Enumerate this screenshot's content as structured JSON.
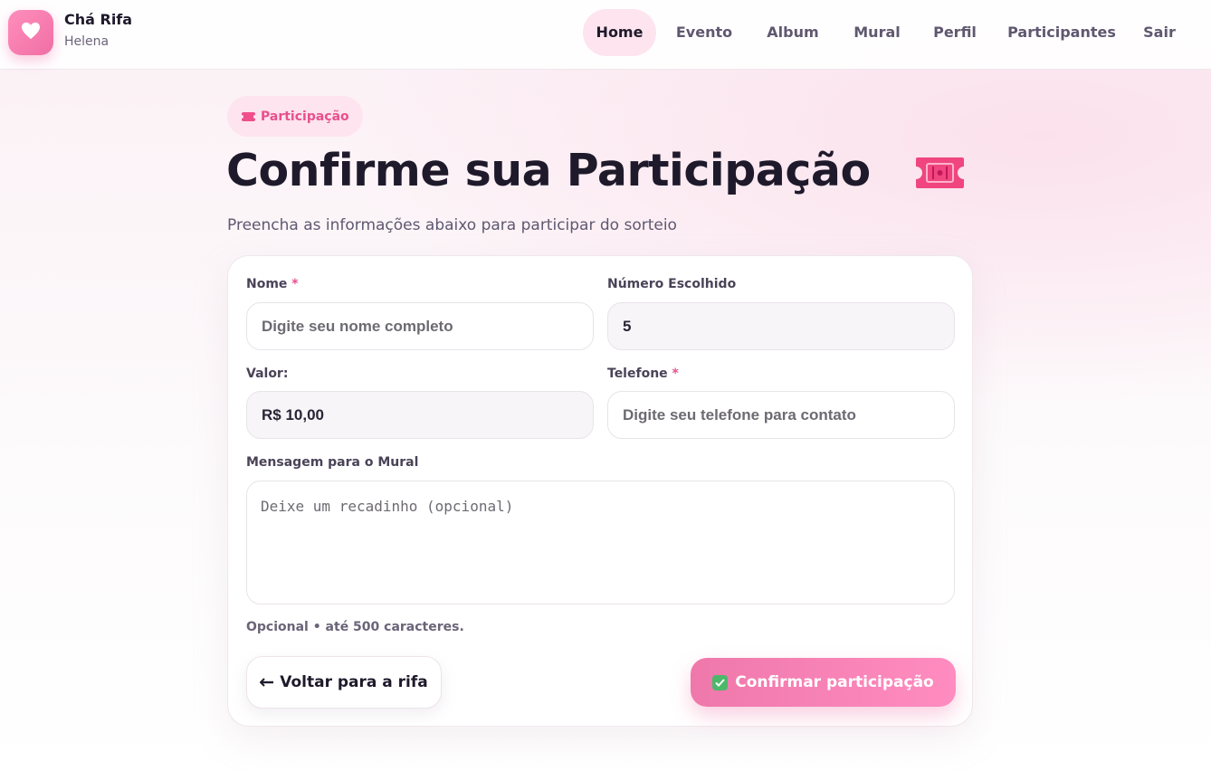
{
  "brand": {
    "name": "Chá Rifa",
    "subtitle": "Helena",
    "logo_icon": "heart-icon"
  },
  "nav": {
    "items": [
      {
        "label": "Home",
        "active": true
      },
      {
        "label": "Evento"
      },
      {
        "label": "Album"
      },
      {
        "label": "Mural"
      },
      {
        "label": "Perfil"
      },
      {
        "label": "Participantes"
      },
      {
        "label": "Sair"
      }
    ]
  },
  "badge": {
    "icon": "ticket-icon",
    "label": "Participação"
  },
  "page": {
    "title": "Confirme sua Participação",
    "title_icon": "ticket-icon",
    "subtitle": "Preencha as informações abaixo para participar do sorteio"
  },
  "form": {
    "nome": {
      "label": "Nome",
      "required_mark": "*",
      "value": "",
      "placeholder": "Digite seu nome completo"
    },
    "numero": {
      "label": "Número Escolhido",
      "value": "5"
    },
    "valor": {
      "label": "Valor:",
      "value": "R$ 10,00"
    },
    "telefone": {
      "label": "Telefone",
      "required_mark": "*",
      "value": "",
      "placeholder": "Digite seu telefone para contato"
    },
    "mensagem": {
      "label": "Mensagem para o Mural",
      "value": "",
      "placeholder": "Deixe um recadinho (opcional)"
    },
    "hint": "Opcional • até 500 caracteres."
  },
  "actions": {
    "back_label": "Voltar para a rifa",
    "back_icon": "arrow-left-icon",
    "confirm_label": "Confirmar participação",
    "confirm_icon": "check-icon"
  },
  "colors": {
    "accent": "#e8508d",
    "accent_light": "#fde4ee",
    "confirm_gradient_start": "#ef78ab",
    "confirm_gradient_end": "#ff8cc0"
  }
}
